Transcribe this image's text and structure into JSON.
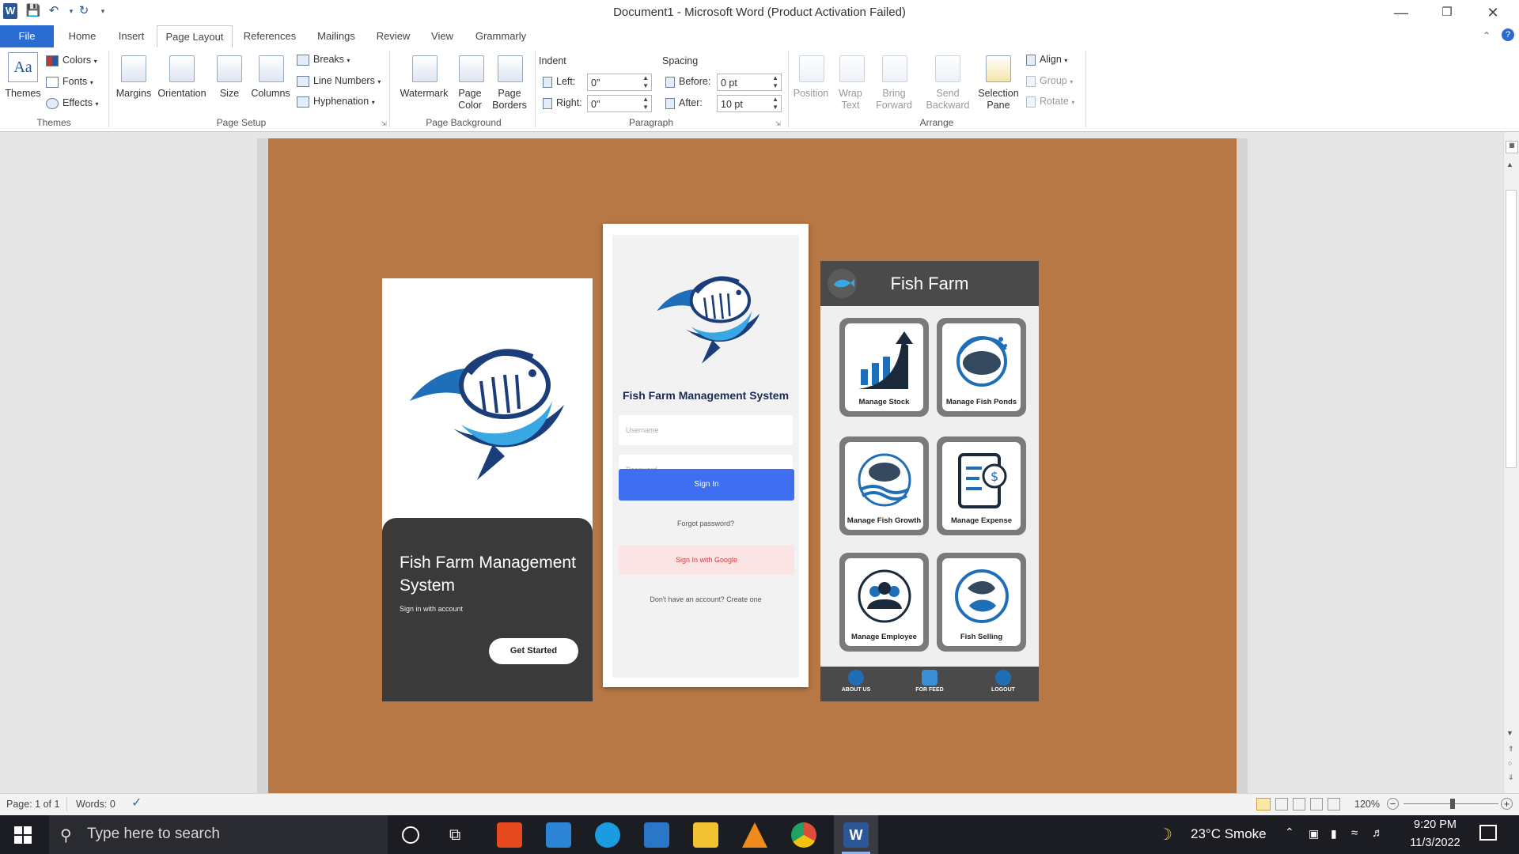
{
  "window": {
    "title": "Document1  -  Microsoft Word (Product Activation Failed)",
    "word_logo": "W"
  },
  "tabs": [
    "File",
    "Home",
    "Insert",
    "Page Layout",
    "References",
    "Mailings",
    "Review",
    "View",
    "Grammarly"
  ],
  "active_tab": "Page Layout",
  "ribbon": {
    "themes": {
      "themes_label": "Themes",
      "colors": "Colors",
      "fonts": "Fonts",
      "effects": "Effects",
      "group": "Themes"
    },
    "page_setup": {
      "margins": "Margins",
      "orientation": "Orientation",
      "size": "Size",
      "columns": "Columns",
      "breaks": "Breaks",
      "line_numbers": "Line Numbers",
      "hyphenation": "Hyphenation",
      "group": "Page Setup"
    },
    "page_background": {
      "watermark": "Watermark",
      "page_color_1": "Page",
      "page_color_2": "Color",
      "page_borders_1": "Page",
      "page_borders_2": "Borders",
      "group": "Page Background"
    },
    "paragraph": {
      "indent": "Indent",
      "left_label": "Left:",
      "left_value": "0\"",
      "right_label": "Right:",
      "right_value": "0\"",
      "spacing": "Spacing",
      "before_label": "Before:",
      "before_value": "0 pt",
      "after_label": "After:",
      "after_value": "10 pt",
      "group": "Paragraph"
    },
    "arrange": {
      "position": "Position",
      "wrap_1": "Wrap",
      "wrap_2": "Text",
      "bring_1": "Bring",
      "bring_2": "Forward",
      "send_1": "Send",
      "send_2": "Backward",
      "selection_1": "Selection",
      "selection_2": "Pane",
      "align": "Align",
      "group_btn": "Group",
      "rotate": "Rotate",
      "group": "Arrange"
    }
  },
  "screen1": {
    "title": "Fish Farm Management System",
    "subtitle": "Sign in with account",
    "button": "Get Started"
  },
  "screen2": {
    "title": "Fish Farm Management System",
    "username_placeholder": "Username",
    "password_placeholder": "Password",
    "sign_in": "Sign In",
    "forgot": "Forgot password?",
    "google": "Sign In with Google",
    "create": "Don't have an account? Create one"
  },
  "screen3": {
    "title": "Fish Farm",
    "tiles": [
      "Manage Stock",
      "Manage Fish Ponds",
      "Manage Fish Growth",
      "Manage Expense",
      "Manage Employee",
      "Fish Selling"
    ],
    "nav": [
      "ABOUT US",
      "FOR FEED",
      "LOGOUT"
    ]
  },
  "statusbar": {
    "page": "Page: 1 of 1",
    "words": "Words: 0",
    "zoom": "120%"
  },
  "taskbar": {
    "search_placeholder": "Type here to search",
    "weather": "23°C  Smoke",
    "time": "9:20 PM",
    "date": "11/3/2022"
  },
  "colors": {
    "page_background": "#b87845",
    "accent_blue": "#3f6ff0",
    "file_tab": "#2b6cd2",
    "dark_panel": "#3a3a3a"
  }
}
